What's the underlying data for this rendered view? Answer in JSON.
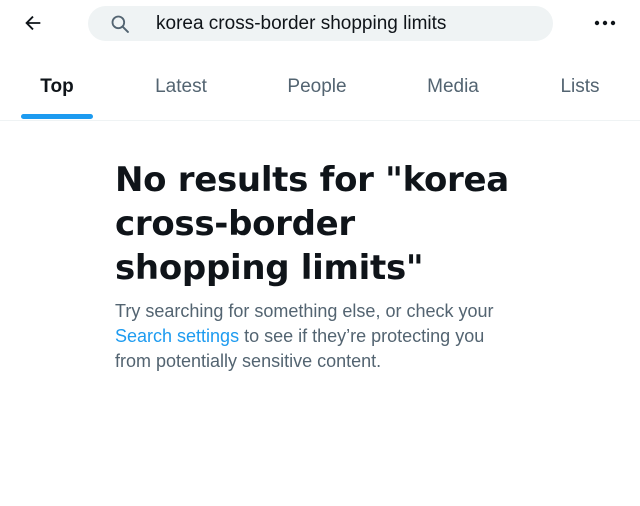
{
  "header": {
    "back_icon": "arrow-left-icon",
    "search": {
      "icon": "search-icon",
      "value": "korea cross-border shopping limits"
    },
    "more_icon": "more-horizontal-icon"
  },
  "tabs": [
    {
      "label": "Top",
      "active": true
    },
    {
      "label": "Latest",
      "active": false
    },
    {
      "label": "People",
      "active": false
    },
    {
      "label": "Media",
      "active": false
    },
    {
      "label": "Lists",
      "active": false
    }
  ],
  "empty_state": {
    "title": "No results for \"korea cross-border shopping limits\"",
    "desc_before": "Try searching for something else, or check your ",
    "link_text": "Search settings",
    "desc_after": " to see if they’re protecting you from potentially sensitive content."
  },
  "colors": {
    "accent": "#1d9bf0",
    "text_primary": "#0f1419",
    "text_secondary": "#536471",
    "search_bg": "#eff3f4"
  }
}
